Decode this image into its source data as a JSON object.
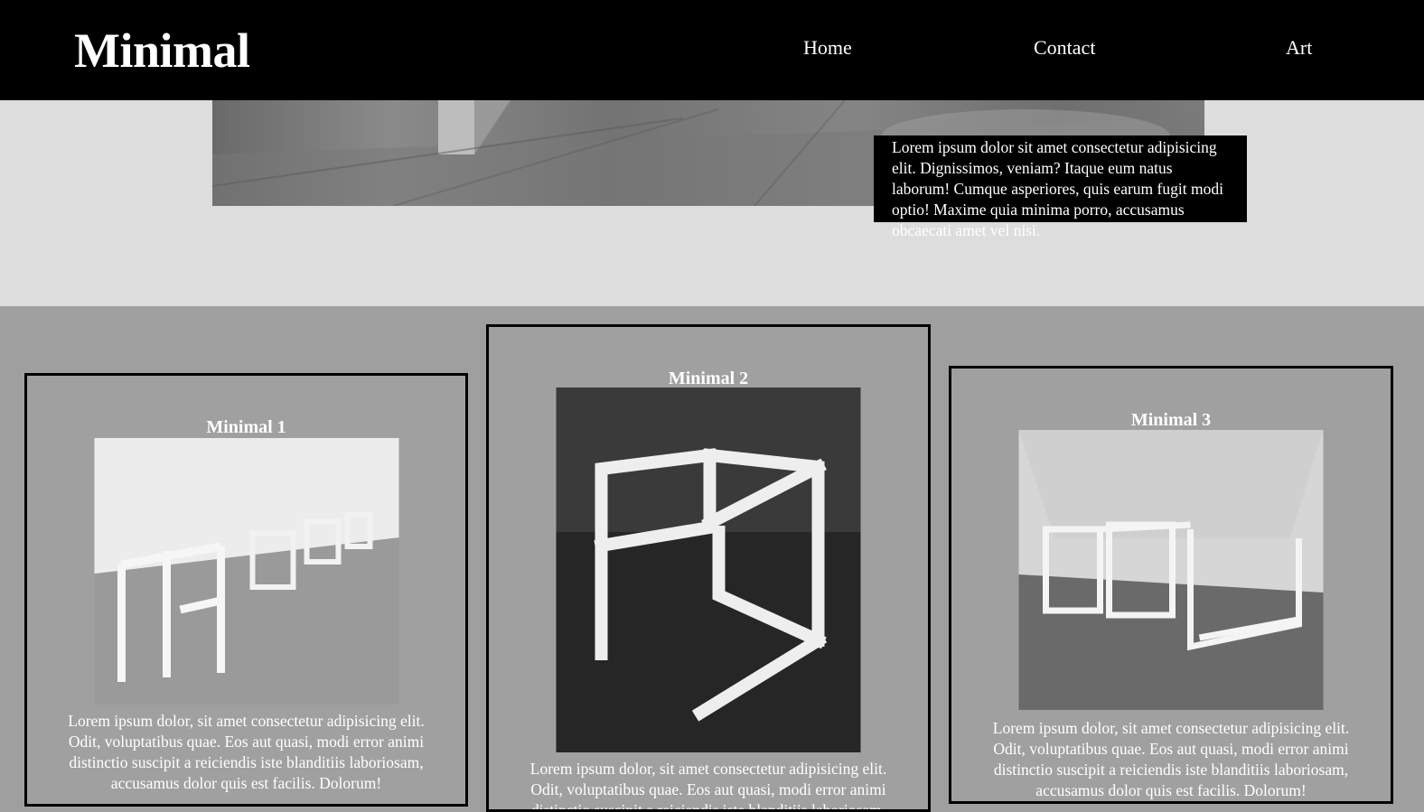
{
  "header": {
    "logo": "Minimal",
    "nav": [
      {
        "label": "Home"
      },
      {
        "label": "Contact"
      },
      {
        "label": "Art"
      }
    ]
  },
  "hero": {
    "caption": "Lorem ipsum dolor sit amet consectetur adipisicing elit. Dignissimos, veniam? Itaque eum natus laborum! Cumque asperiores, quis earum fugit modi optio! Maxime quia minima porro, accusamus obcaecati amet vel nisi."
  },
  "cards": [
    {
      "title": "Minimal 1",
      "text": "Lorem ipsum dolor, sit amet consectetur adipisicing elit. Odit, voluptatibus quae. Eos aut quasi, modi error animi distinctio suscipit a reiciendis iste blanditiis laboriosam, accusamus dolor quis est facilis. Dolorum!"
    },
    {
      "title": "Minimal 2",
      "text": "Lorem ipsum dolor, sit amet consectetur adipisicing elit. Odit, voluptatibus quae. Eos aut quasi, modi error animi distinctio suscipit a reiciendis iste blanditiis laboriosam, accusamus dolor quis est facilis. Dolorum!"
    },
    {
      "title": "Minimal 3",
      "text": "Lorem ipsum dolor, sit amet consectetur adipisicing elit. Odit, voluptatibus quae. Eos aut quasi, modi error animi distinctio suscipit a reiciendis iste blanditiis laboriosam, accusamus dolor quis est facilis. Dolorum!"
    }
  ]
}
